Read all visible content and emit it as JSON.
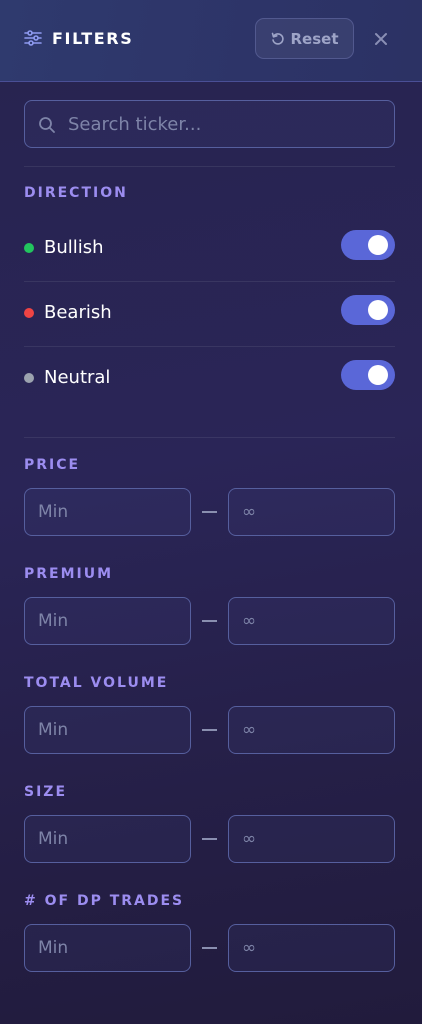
{
  "header": {
    "title": "FILTERS",
    "title_icon": "sliders-icon",
    "reset_label": "Reset",
    "reset_icon": "rotate-ccw-icon",
    "close_icon": "close-icon"
  },
  "search": {
    "placeholder": "Search ticker...",
    "value": ""
  },
  "direction": {
    "label": "DIRECTION",
    "items": [
      {
        "name": "Bullish",
        "color": "#22c55e",
        "enabled": true
      },
      {
        "name": "Bearish",
        "color": "#ef4444",
        "enabled": true
      },
      {
        "name": "Neutral",
        "color": "#9ca3af",
        "enabled": true
      }
    ]
  },
  "ranges": [
    {
      "label": "PRICE",
      "min_placeholder": "Min",
      "max_placeholder": "∞"
    },
    {
      "label": "PREMIUM",
      "min_placeholder": "Min",
      "max_placeholder": "∞"
    },
    {
      "label": "TOTAL VOLUME",
      "min_placeholder": "Min",
      "max_placeholder": "∞"
    },
    {
      "label": "SIZE",
      "min_placeholder": "Min",
      "max_placeholder": "∞"
    },
    {
      "label": "# OF DP TRADES",
      "min_placeholder": "Min",
      "max_placeholder": "∞"
    }
  ],
  "colors": {
    "accent": "#5a67d8",
    "section_label": "#9c8df0"
  }
}
